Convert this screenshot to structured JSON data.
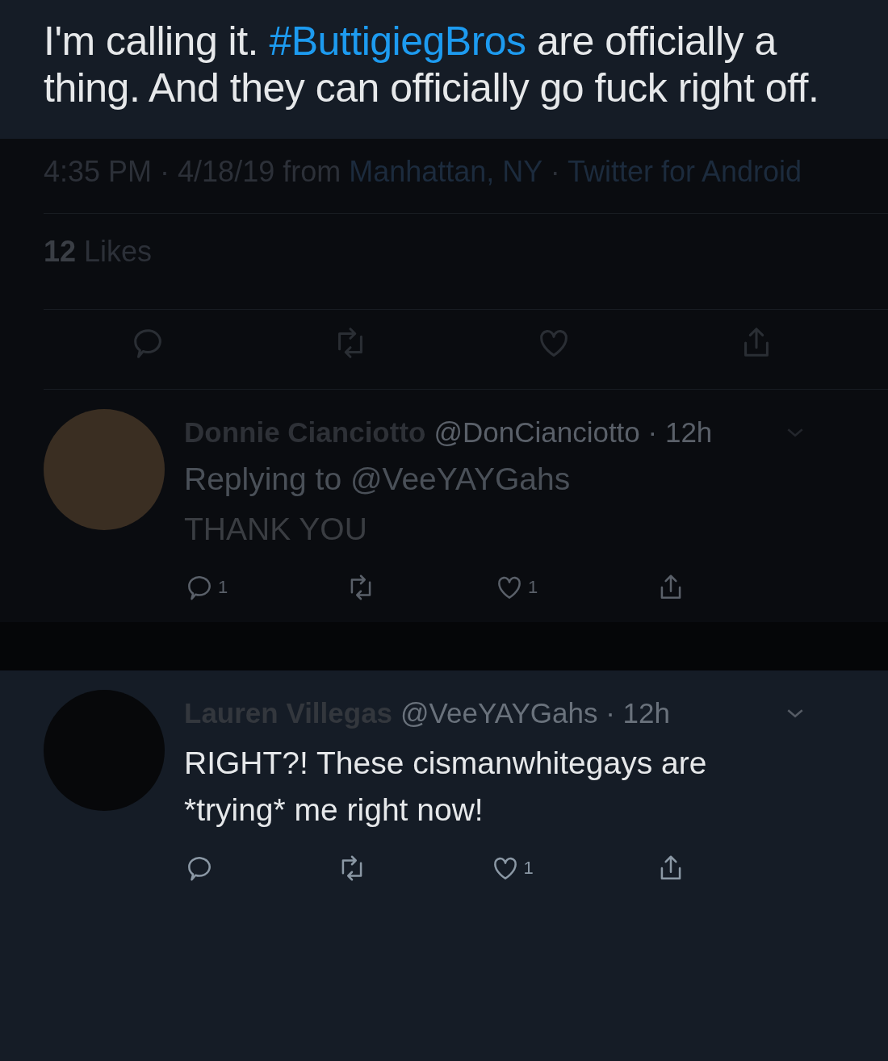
{
  "tweet": {
    "text_before": "I'm calling it.",
    "hashtag": "#ButtigiegBros",
    "text_after": "are officially a thing. And they can officially go fuck right off.",
    "meta": "4:35 PM · 4/18/19 from",
    "location": "Manhattan, NY",
    "separator": "·",
    "source": "Twitter for Android",
    "likes_count": "12",
    "likes_label": "Likes"
  },
  "replies": [
    {
      "name": "Donnie Cianciotto",
      "handle_time": "@DonCianciotto · 12h",
      "replying_to": "Replying to @VeeYAYGahs",
      "text": "THANK YOU",
      "reply_count": "1",
      "like_count": "1",
      "dimmed": true
    },
    {
      "name": "Lauren Villegas",
      "handle_time": "@VeeYAYGahs · 12h",
      "text": "RIGHT?! These cismanwhitegays are *trying* me right now!",
      "like_count": "1",
      "dimmed": false
    }
  ]
}
